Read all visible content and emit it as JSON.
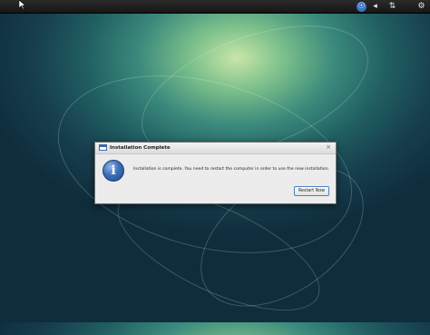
{
  "desktop": {
    "tray": [
      {
        "name": "accessibility-icon",
        "glyph": "☉",
        "color": "#4a7fd1"
      },
      {
        "name": "volume-icon",
        "glyph": "◀)",
        "color": "#e8e8e8"
      },
      {
        "name": "network-icon",
        "glyph": "⇅",
        "color": "#e8e8e8"
      },
      {
        "name": "settings-gear-icon",
        "glyph": "⚙",
        "color": "#e8e8e8"
      }
    ]
  },
  "dialog": {
    "title": "Installation Complete",
    "close_glyph": "×",
    "icon": "info-icon",
    "icon_glyph": "i",
    "message": "Installation is complete. You need to restart the computer in order to use the new installation.",
    "button_label": "Restart Now"
  },
  "colors": {
    "accent": "#4f7fc0",
    "topbar": "#1d1d1d"
  }
}
